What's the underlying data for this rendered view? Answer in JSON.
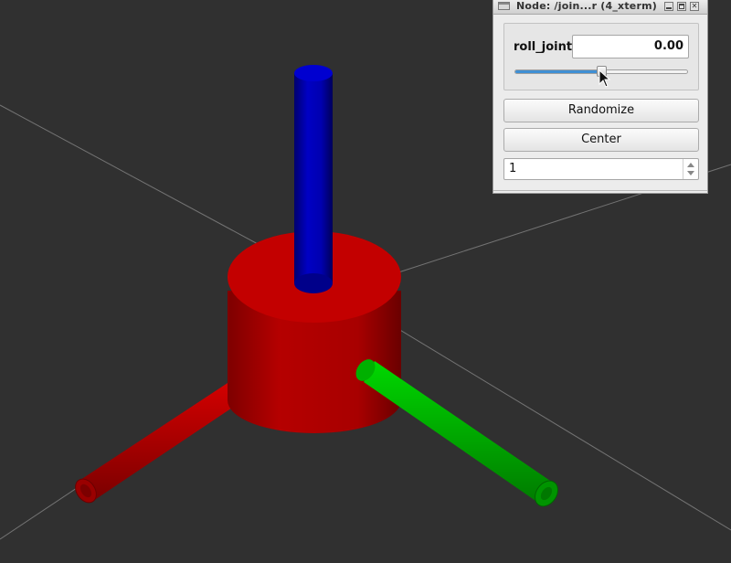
{
  "window": {
    "title": "Node: /join...r (4_xterm)",
    "controls": [
      "minimize-icon",
      "maximize-icon",
      "close-icon"
    ]
  },
  "joint": {
    "name": "roll_joint",
    "value": "0.00",
    "slider_fraction": 0.5
  },
  "buttons": {
    "randomize": "Randomize",
    "center": "Center"
  },
  "spinbox": {
    "value": "1"
  },
  "scene": {
    "background": "#303030",
    "grid_color": "#8a8a8a",
    "base_cylinder_color": "#b40000",
    "x_axis_color": "#cc0000",
    "y_axis_color": "#00c800",
    "z_axis_color": "#0000b4"
  }
}
